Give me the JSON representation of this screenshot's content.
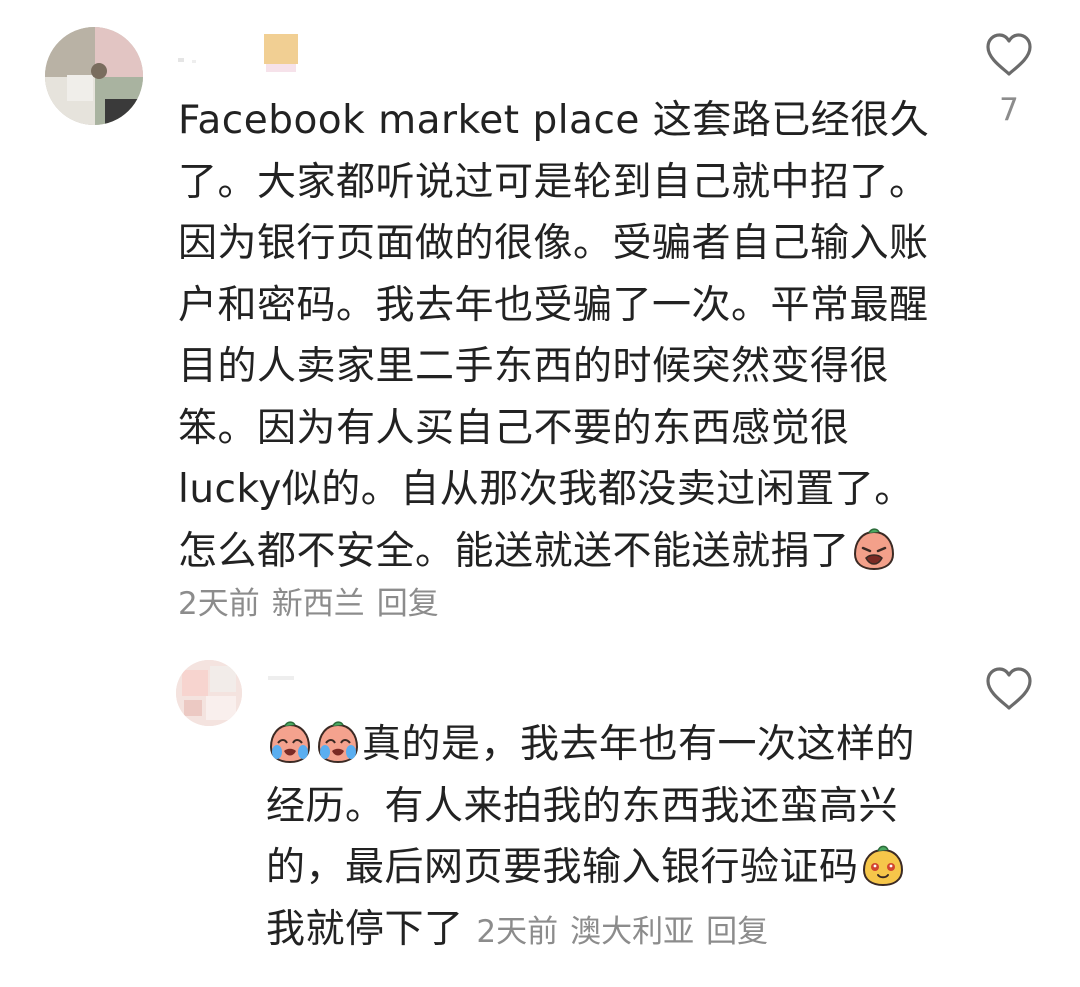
{
  "comment": {
    "body_lines": [
      "Facebook market place 这套路已经很久",
      "了。大家都听说过可是轮到自己就中招了。",
      "因为银行页面做的很像。受骗者自己输入账",
      "户和密码。我去年也受骗了一次。平常最醒",
      "目的人卖家里二手东西的时候突然变得很",
      "笨。因为有人买自己不要的东西感觉很",
      "lucky似的。自从那次我都没卖过闲置了。",
      "怎么都不安全。能送就送不能送就捐了"
    ],
    "trailing_emoji": "crying-face-emoji",
    "time": "2天前",
    "location": "新西兰",
    "reply_label": "回复",
    "like_count": "7",
    "like_icon": "heart-outline-icon"
  },
  "reply": {
    "leading_emojis": [
      "tearful-face-emoji",
      "tearful-face-emoji"
    ],
    "body_lines": [
      "真的是，我去年也有一次这样的",
      "经历。有人来拍我的东西我还蛮高兴",
      "的，最后网页要我输入银行验证码"
    ],
    "mid_emoji": "peeking-face-emoji",
    "body_last": "我就停下了",
    "time": "2天前",
    "location": "澳大利亚",
    "reply_label": "回复",
    "like_icon": "heart-outline-icon"
  },
  "colors": {
    "text": "#222222",
    "meta": "#8c8c8c",
    "background": "#ffffff"
  }
}
